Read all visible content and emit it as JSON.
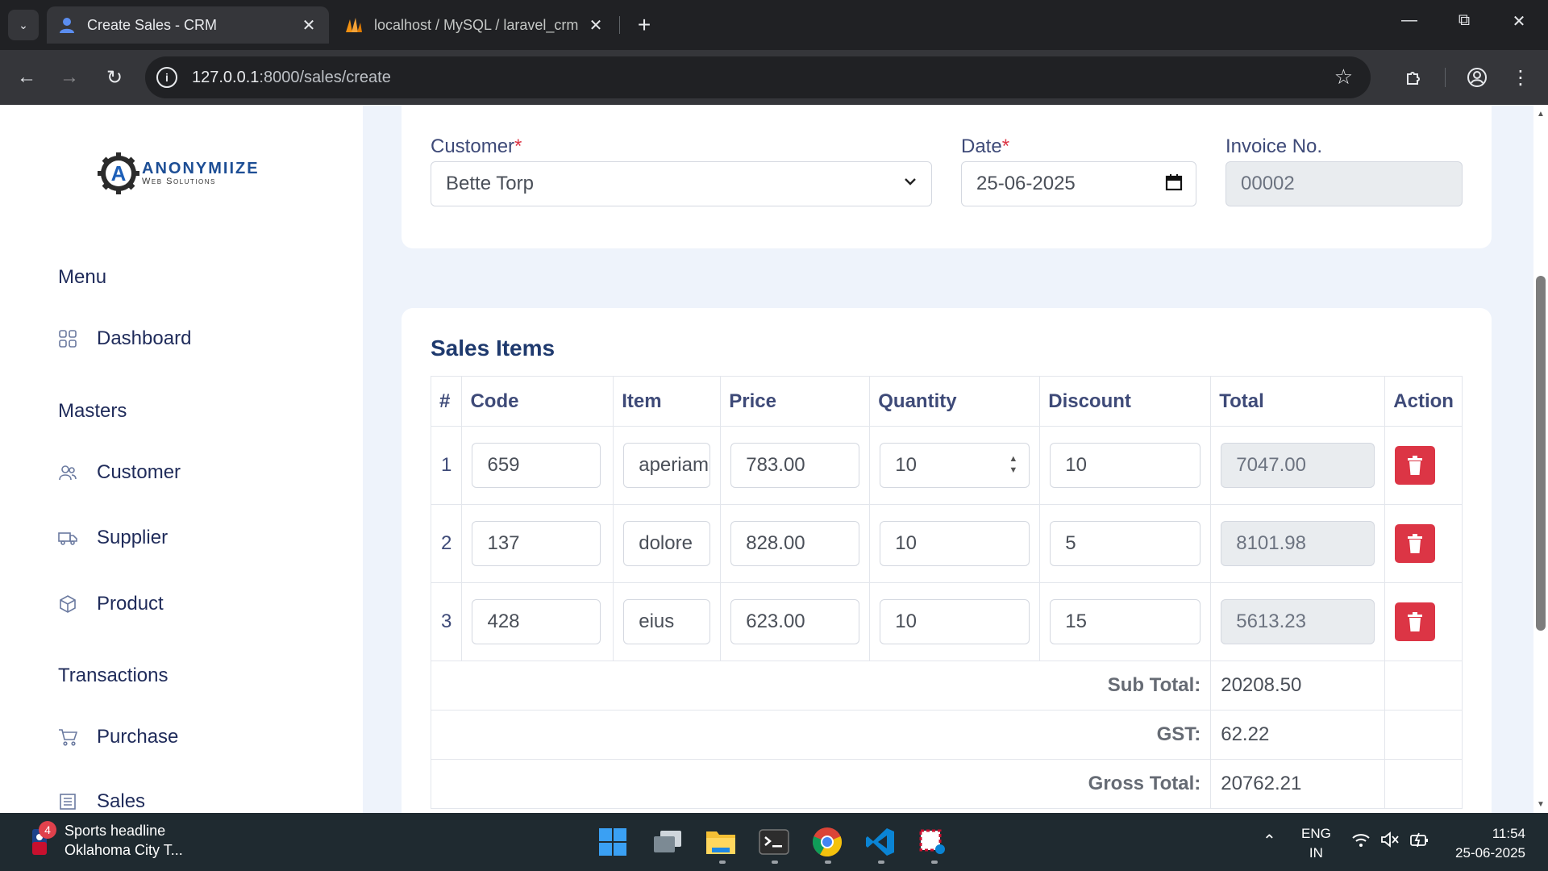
{
  "browser": {
    "tabs": [
      {
        "title": "Create Sales - CRM",
        "active": true
      },
      {
        "title": "localhost / MySQL / laravel_crm",
        "active": false
      }
    ],
    "url_host": "127.0.0.1",
    "url_path": ":8000/sales/create"
  },
  "sidebar": {
    "logo_big": "ANONYMIIZE",
    "logo_small": "Web Solutions",
    "logo_mark": "A",
    "headings": {
      "menu": "Menu",
      "masters": "Masters",
      "transactions": "Transactions"
    },
    "items": [
      {
        "label": "Dashboard",
        "icon": "grid-icon"
      },
      {
        "label": "Customer",
        "icon": "users-icon"
      },
      {
        "label": "Supplier",
        "icon": "truck-icon"
      },
      {
        "label": "Product",
        "icon": "box-icon"
      },
      {
        "label": "Purchase",
        "icon": "cart-icon"
      },
      {
        "label": "Sales",
        "icon": "receipt-icon"
      }
    ]
  },
  "form": {
    "customer_label": "Customer",
    "customer_value": "Bette Torp",
    "date_label": "Date",
    "date_value": "25-06-2025",
    "invoice_label": "Invoice No.",
    "invoice_value": "00002",
    "required_mark": "*"
  },
  "items": {
    "title": "Sales Items",
    "columns": [
      "#",
      "Code",
      "Item",
      "Price",
      "Quantity",
      "Discount",
      "Total",
      "Action"
    ],
    "rows": [
      {
        "idx": "1",
        "code": "659",
        "item": "aperiam",
        "price": "783.00",
        "qty": "10",
        "discount": "10",
        "total": "7047.00"
      },
      {
        "idx": "2",
        "code": "137",
        "item": "dolore",
        "price": "828.00",
        "qty": "10",
        "discount": "5",
        "total": "8101.98"
      },
      {
        "idx": "3",
        "code": "428",
        "item": "eius",
        "price": "623.00",
        "qty": "10",
        "discount": "15",
        "total": "5613.23"
      }
    ],
    "summary": {
      "sub_total_label": "Sub Total:",
      "sub_total": "20208.50",
      "gst_label": "GST:",
      "gst": "62.22",
      "gross_total_label": "Gross Total:",
      "gross_total": "20762.21"
    }
  },
  "taskbar": {
    "news_badge": "4",
    "news_title": "Sports headline",
    "news_sub": "Oklahoma City T...",
    "lang": "ENG",
    "region": "IN",
    "time": "11:54",
    "date": "25-06-2025"
  },
  "colors": {
    "accent": "#1f3a6e",
    "danger": "#dc3545",
    "page_bg": "#eef3fb"
  }
}
